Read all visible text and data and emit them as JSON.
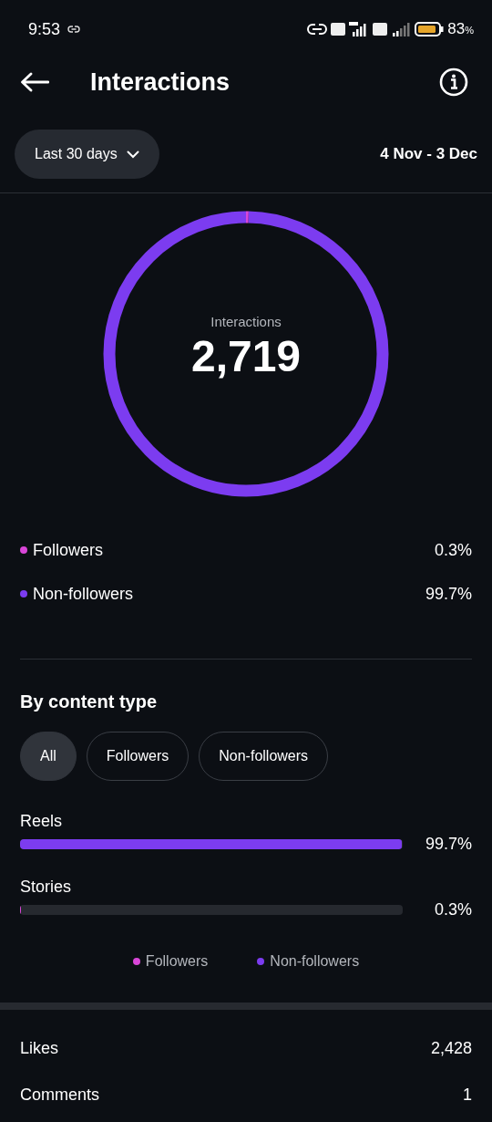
{
  "status_bar": {
    "time": "9:53",
    "battery_percent": "83",
    "battery_percent_sign": "%"
  },
  "header": {
    "title": "Interactions"
  },
  "filter": {
    "range": "Last 30 days",
    "dates": "4 Nov - 3 Dec"
  },
  "summary": {
    "label": "Interactions",
    "total": "2,719"
  },
  "audience": [
    {
      "label": "Followers",
      "value": "0.3%",
      "color": "#d946d8"
    },
    {
      "label": "Non-followers",
      "value": "99.7%",
      "color": "#7c3cf0"
    }
  ],
  "by_content_type": {
    "title": "By content type",
    "tabs": [
      {
        "label": "All",
        "selected": true
      },
      {
        "label": "Followers",
        "selected": false
      },
      {
        "label": "Non-followers",
        "selected": false
      }
    ],
    "rows": [
      {
        "label": "Reels",
        "level": 0.997,
        "value": "99.7%",
        "color": "#7c3cf0"
      },
      {
        "label": "Stories",
        "level": 0.003,
        "value": "0.3%",
        "color": "#d946d8"
      }
    ],
    "legend": [
      {
        "label": "Followers",
        "color": "#d946d8"
      },
      {
        "label": "Non-followers",
        "color": "#7c3cf0"
      }
    ]
  },
  "metrics": [
    {
      "label": "Likes",
      "value": "2,428"
    },
    {
      "label": "Comments",
      "value": "1"
    }
  ]
}
